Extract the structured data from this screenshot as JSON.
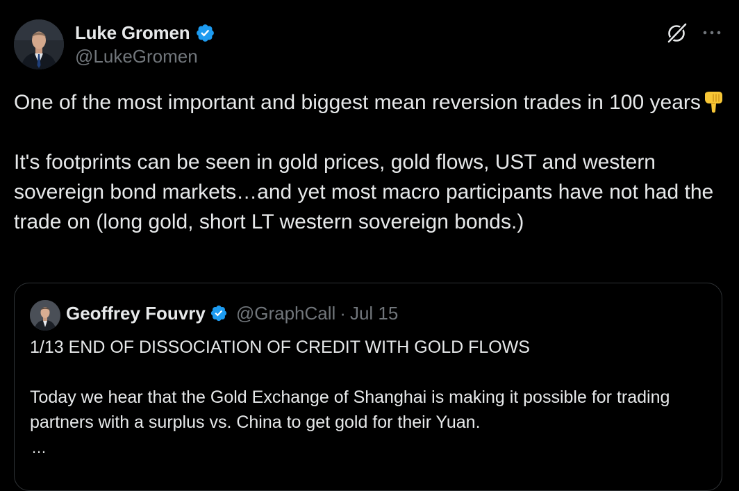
{
  "author": {
    "name": "Luke Gromen",
    "handle": "@LukeGromen",
    "verified": true
  },
  "tweet": {
    "paragraph1_text": "One of the most important and biggest mean reversion trades in 100 years",
    "paragraph1_emoji": "pointing-down-emoji",
    "paragraph2_text": "It's footprints can be seen in gold prices, gold flows, UST and western sovereign bond markets…and yet most macro participants have not had the trade on (long gold, short LT western sovereign bonds.)"
  },
  "quoted_tweet": {
    "author_name": "Geoffrey Fouvry",
    "author_handle": "@GraphCall",
    "separator": "·",
    "date": "Jul 15",
    "verified": true,
    "line1": "1/13 END OF DISSOCIATION OF CREDIT WITH GOLD FLOWS",
    "line2": "Today we hear that the Gold Exchange of Shanghai is making it possible for trading partners with a surplus vs. China to get gold for their Yuan.",
    "ellipsis": "…"
  },
  "icons": {
    "verified": "verified-badge-icon",
    "grok": "grok-icon",
    "more": "more-options-icon"
  },
  "colors": {
    "background": "#000000",
    "text_primary": "#e7e9ea",
    "text_secondary": "#71767b",
    "verified_blue": "#1d9bf0",
    "border": "#2f3336"
  }
}
